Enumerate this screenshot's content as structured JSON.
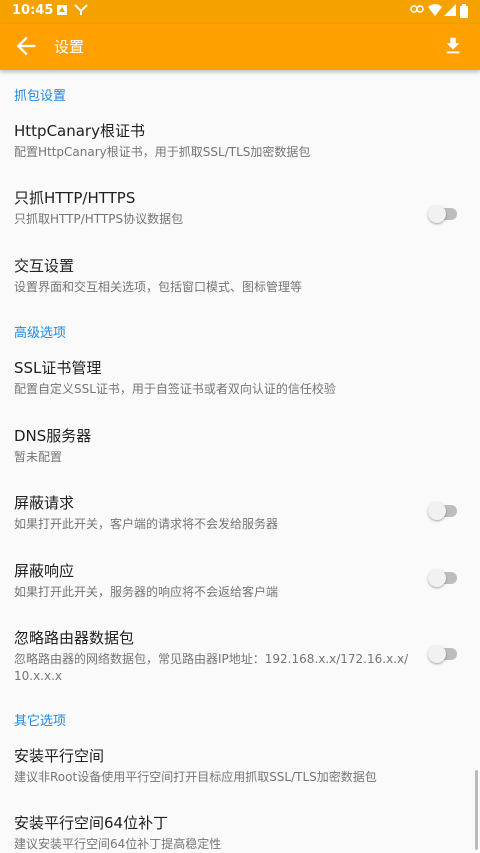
{
  "status_bar": {
    "time": "10:45",
    "left_icons": [
      "notification-icon",
      "app-icon"
    ],
    "right_icons": [
      "link-icon",
      "wifi-icon",
      "signal-icon",
      "battery-icon"
    ]
  },
  "toolbar": {
    "title": "设置",
    "back_icon": "arrow-back-icon",
    "action_icon": "download-icon",
    "color": "#ffa000"
  },
  "sections": [
    {
      "header": "抓包设置",
      "items": [
        {
          "title": "HttpCanary根证书",
          "summary": "配置HttpCanary根证书，用于抓取SSL/TLS加密数据包"
        },
        {
          "title": "只抓HTTP/HTTPS",
          "summary": "只抓取HTTP/HTTPS协议数据包",
          "switch": false
        },
        {
          "title": "交互设置",
          "summary": "设置界面和交互相关选项，包括窗口模式、图标管理等"
        }
      ]
    },
    {
      "header": "高级选项",
      "items": [
        {
          "title": "SSL证书管理",
          "summary": "配置自定义SSL证书，用于自签证书或者双向认证的信任校验"
        },
        {
          "title": "DNS服务器",
          "summary": "暂未配置"
        },
        {
          "title": "屏蔽请求",
          "summary": "如果打开此开关，客户端的请求将不会发给服务器",
          "switch": false
        },
        {
          "title": "屏蔽响应",
          "summary": "如果打开此开关，服务器的响应将不会返给客户端",
          "switch": false
        },
        {
          "title": "忽略路由器数据包",
          "summary_line1": "忽略路由器的网络数据包，常见路由器IP地址：192.168.x.x/172.16.x.x/",
          "summary_line2": "10.x.x.x",
          "switch": false
        }
      ]
    },
    {
      "header": "其它选项",
      "items": [
        {
          "title": "安装平行空间",
          "summary": "建议非Root设备使用平行空间打开目标应用抓取SSL/TLS加密数据包"
        },
        {
          "title": "安装平行空间64位补丁",
          "summary": "建议安装平行空间64位补丁提高稳定性"
        }
      ]
    }
  ],
  "colors": {
    "accent": "#1e88e5",
    "toolbar": "#ffa000",
    "switch_off": "#bdbdbd"
  }
}
